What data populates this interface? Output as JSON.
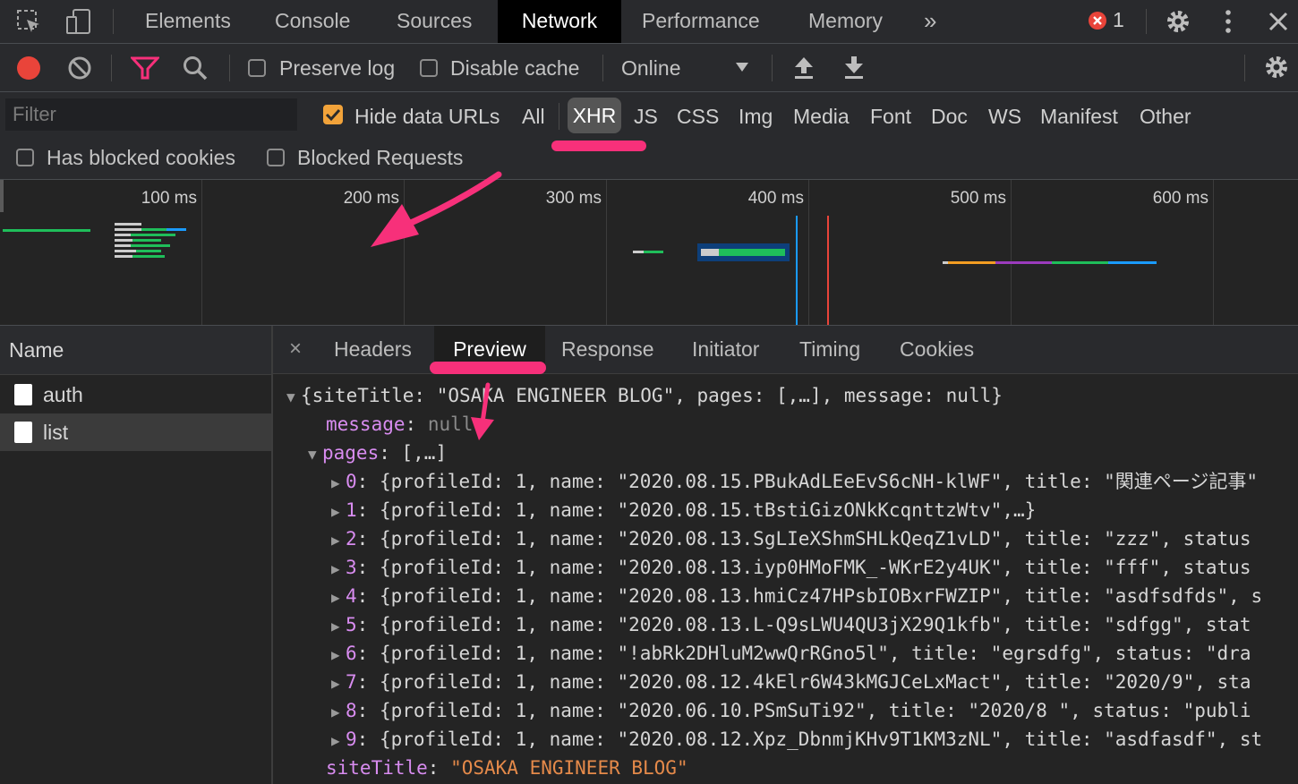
{
  "tabs": [
    "Elements",
    "Console",
    "Sources",
    "Network",
    "Performance",
    "Memory"
  ],
  "error_count": "1",
  "toolbar": {
    "preserve_log": "Preserve log",
    "disable_cache": "Disable cache",
    "throttle": "Online"
  },
  "filter": {
    "placeholder": "Filter",
    "hide_data_urls": "Hide data URLs",
    "types": [
      "All",
      "XHR",
      "JS",
      "CSS",
      "Img",
      "Media",
      "Font",
      "Doc",
      "WS",
      "Manifest",
      "Other"
    ],
    "has_blocked_cookies": "Has blocked cookies",
    "blocked_requests": "Blocked Requests"
  },
  "overview": {
    "ticks": [
      "100 ms",
      "200 ms",
      "300 ms",
      "400 ms",
      "500 ms",
      "600 ms"
    ]
  },
  "names": {
    "header": "Name",
    "items": [
      "auth",
      "list"
    ]
  },
  "detail": {
    "close": "×",
    "tabs": [
      "Headers",
      "Preview",
      "Response",
      "Initiator",
      "Timing",
      "Cookies"
    ]
  },
  "preview": {
    "root": "{siteTitle: \"OSAKA ENGINEER BLOG\", pages: [,…], message: null}",
    "message_key": "message",
    "message_val": "null",
    "pages_key": "pages",
    "pages_val": "[,…]",
    "rows": [
      {
        "idx": "0",
        "text": "{profileId: 1, name: \"2020.08.15.PBukAdLEeEvS6cNH-klWF\", title: \"関連ページ記事\""
      },
      {
        "idx": "1",
        "text": "{profileId: 1, name: \"2020.08.15.tBstiGizONkKcqnttzWtv\",…}"
      },
      {
        "idx": "2",
        "text": "{profileId: 1, name: \"2020.08.13.SgLIeXShmSHLkQeqZ1vLD\", title: \"zzz\", status"
      },
      {
        "idx": "3",
        "text": "{profileId: 1, name: \"2020.08.13.iyp0HMoFMK_-WKrE2y4UK\", title: \"fff\", status"
      },
      {
        "idx": "4",
        "text": "{profileId: 1, name: \"2020.08.13.hmiCz47HPsbIOBxrFWZIP\", title: \"asdfsdfds\", s"
      },
      {
        "idx": "5",
        "text": "{profileId: 1, name: \"2020.08.13.L-Q9sLWU4QU3jX29Q1kfb\", title: \"sdfgg\", stat"
      },
      {
        "idx": "6",
        "text": "{profileId: 1, name: \"!abRk2DHluM2wwQrRGno5l\", title: \"egrsdfg\", status: \"dra"
      },
      {
        "idx": "7",
        "text": "{profileId: 1, name: \"2020.08.12.4kElr6W43kMGJCeLxMact\", title: \"2020/9\", sta"
      },
      {
        "idx": "8",
        "text": "{profileId: 1, name: \"2020.06.10.PSmSuTi92\", title: \"2020/8 \", status: \"publi"
      },
      {
        "idx": "9",
        "text": "{profileId: 1, name: \"2020.08.12.Xpz_DbnmjKHv9T1KM3zNL\", title: \"asdfasdf\", st"
      }
    ],
    "site_key": "siteTitle",
    "site_val": "\"OSAKA ENGINEER BLOG\""
  },
  "colors": {
    "accent_annotation": "#f7307a",
    "record_red": "#e9443a",
    "checkbox_orange": "#f2a33a",
    "key_purple": "#d88cf0",
    "string_orange": "#e58a4a"
  }
}
